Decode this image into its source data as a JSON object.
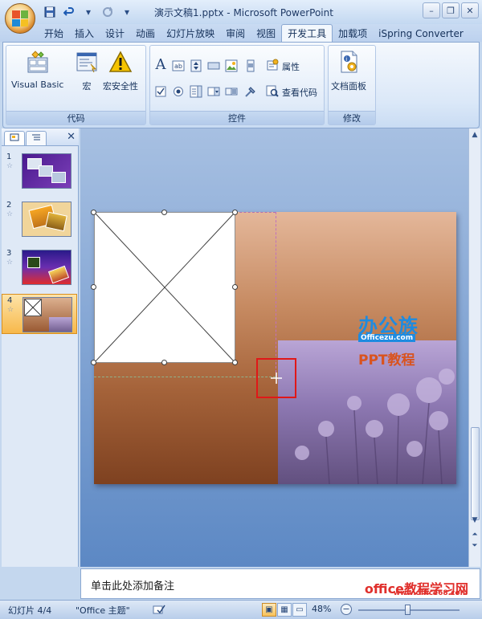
{
  "window": {
    "title": "演示文稿1.pptx - Microsoft PowerPoint"
  },
  "quick_access": {
    "save": "save-icon",
    "undo": "undo-icon",
    "redo": "redo-icon",
    "customize": "▾"
  },
  "tabs": [
    {
      "label": "开始"
    },
    {
      "label": "插入"
    },
    {
      "label": "设计"
    },
    {
      "label": "动画"
    },
    {
      "label": "幻灯片放映"
    },
    {
      "label": "审阅"
    },
    {
      "label": "视图"
    },
    {
      "label": "开发工具",
      "active": true
    },
    {
      "label": "加载项"
    },
    {
      "label": "iSpring Converter"
    }
  ],
  "ribbon": {
    "code_group": {
      "label": "代码",
      "visual_basic": "Visual Basic",
      "macro": "宏",
      "macro_security": "宏安全性"
    },
    "controls_group": {
      "label": "控件",
      "properties": "属性",
      "view_code": "查看代码"
    },
    "modify_group": {
      "label": "修改",
      "document_panel": "文档面板"
    }
  },
  "slides_pane": {
    "slides": [
      {
        "number": "1"
      },
      {
        "number": "2"
      },
      {
        "number": "3"
      },
      {
        "number": "4",
        "active": true
      }
    ]
  },
  "slide": {
    "watermark_title": "办公族",
    "watermark_sub": "Officezu.com",
    "watermark_ppt": "PPT教程"
  },
  "notes": {
    "placeholder": "单击此处添加备注"
  },
  "watermark": {
    "site": "office教程学习网",
    "url": "www.office68.com"
  },
  "status": {
    "slide_indicator": "幻灯片 4/4",
    "theme": "\"Office 主题\"",
    "zoom": "48%"
  },
  "colors": {
    "accent": "#f7b84a",
    "ribbon": "#dbe8f8",
    "frame": "#8ba8d1"
  }
}
